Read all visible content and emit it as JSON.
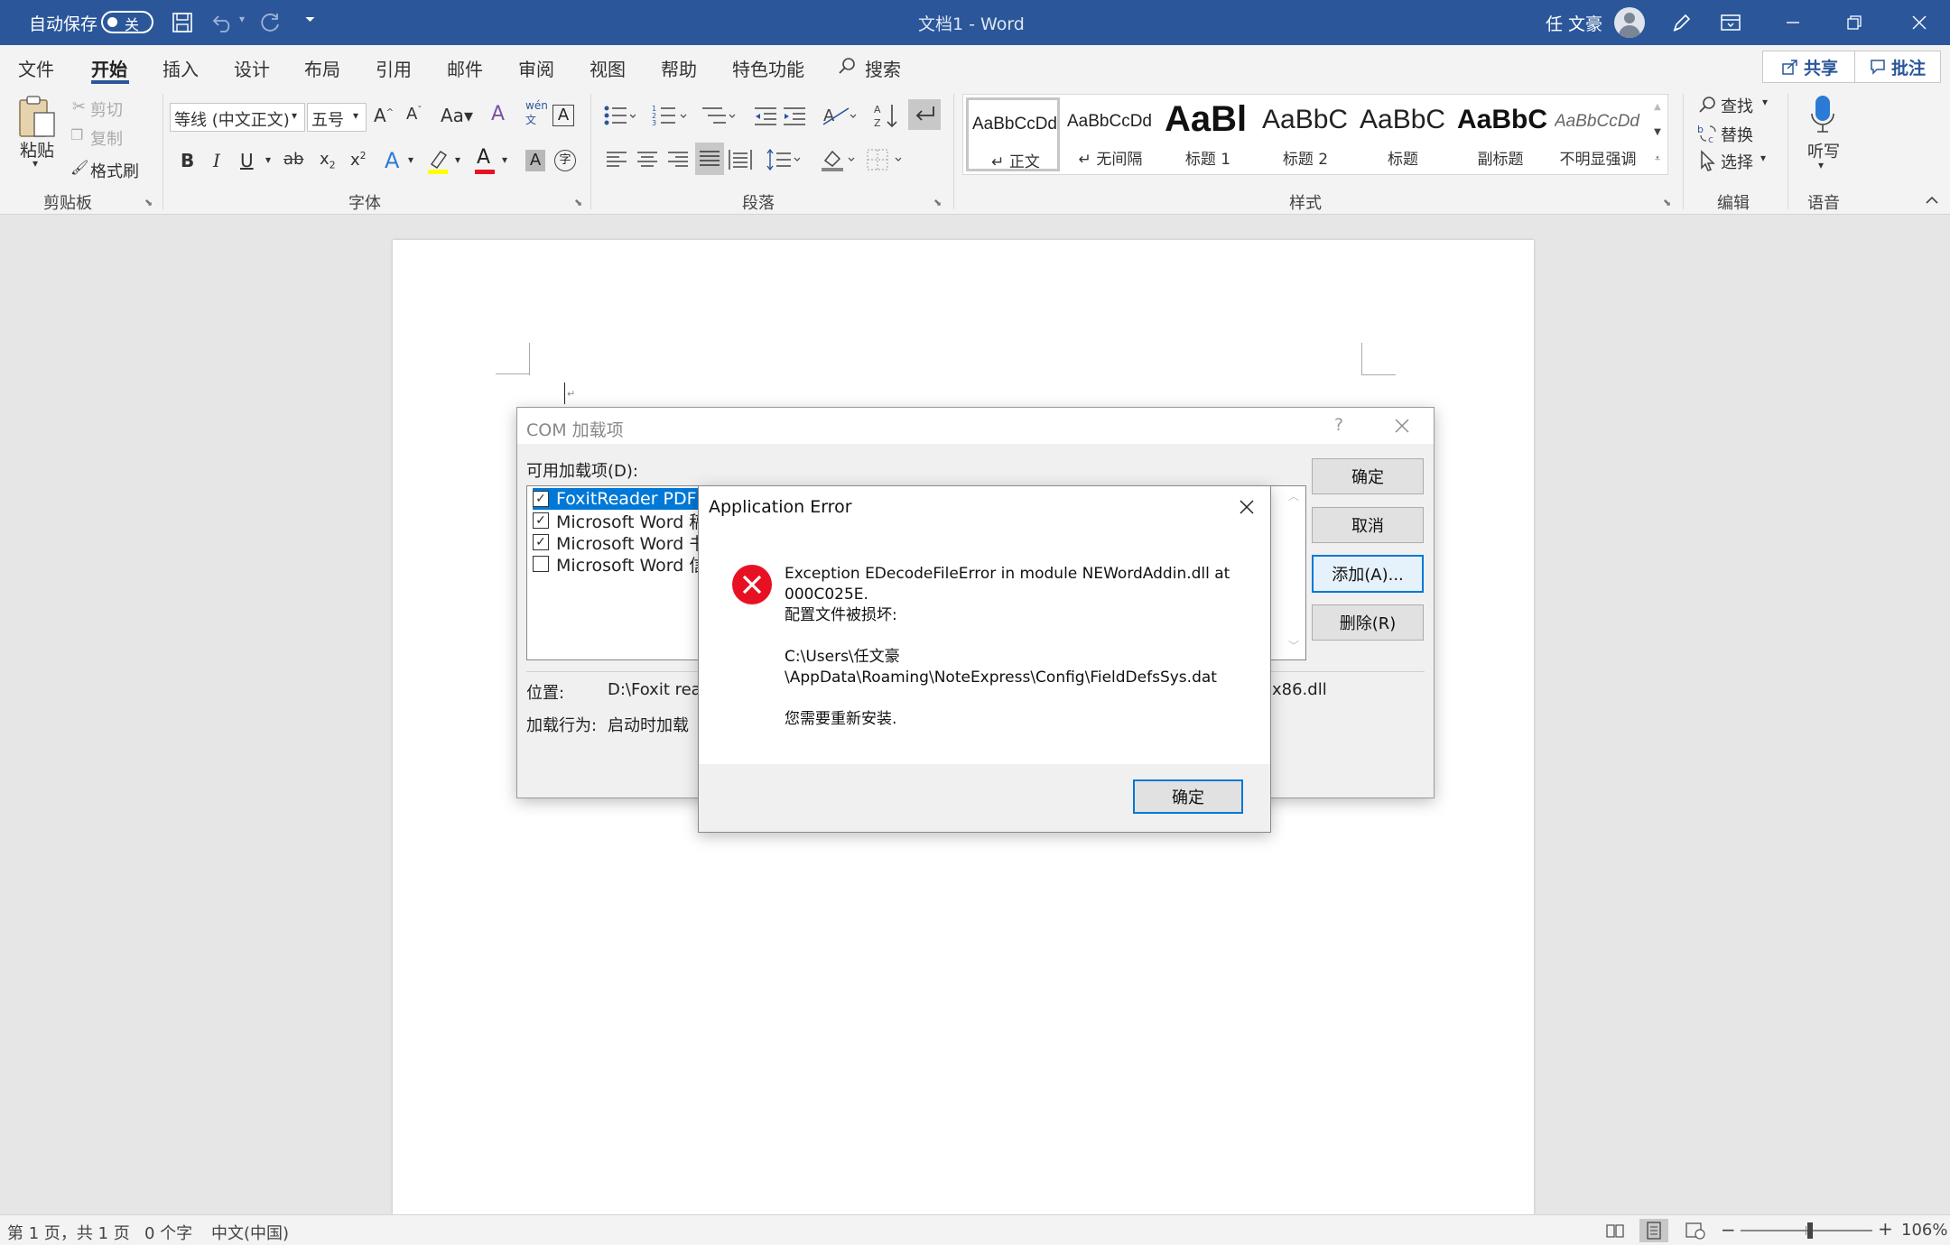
{
  "titlebar": {
    "autosave_label": "自动保存",
    "autosave_state": "关",
    "doc_title": "文档1  -  Word",
    "user_name": "任 文豪"
  },
  "menu": {
    "items": [
      "文件",
      "开始",
      "插入",
      "设计",
      "布局",
      "引用",
      "邮件",
      "审阅",
      "视图",
      "帮助",
      "特色功能"
    ],
    "search": "搜索",
    "share": "共享",
    "comment": "批注"
  },
  "ribbon": {
    "clipboard": {
      "paste": "粘贴",
      "cut": "剪切",
      "copy": "复制",
      "format_painter": "格式刷",
      "label": "剪贴板"
    },
    "font": {
      "font_name": "等线 (中文正文)",
      "font_size": "五号",
      "label": "字体"
    },
    "paragraph": {
      "label": "段落"
    },
    "styles": {
      "items": [
        {
          "preview": "AaBbCcDd",
          "name": "正文"
        },
        {
          "preview": "AaBbCcDd",
          "name": "无间隔"
        },
        {
          "preview": "AaBl",
          "name": "标题 1"
        },
        {
          "preview": "AaBbC",
          "name": "标题 2"
        },
        {
          "preview": "AaBbC",
          "name": "标题"
        },
        {
          "preview": "AaBbC",
          "name": "副标题"
        },
        {
          "preview": "AaBbCcDd",
          "name": "不明显强调"
        }
      ],
      "label": "样式"
    },
    "editing": {
      "find": "查找",
      "replace": "替换",
      "select": "选择",
      "label": "编辑"
    },
    "voice": {
      "dictate": "听写",
      "label": "语音"
    }
  },
  "com_dialog": {
    "title": "COM 加载项",
    "help": "?",
    "available_label": "可用加载项(D):",
    "addins": [
      {
        "name": "FoxitReader PDF Cr",
        "checked": true,
        "selected": true
      },
      {
        "name": "Microsoft Word 稿纸",
        "checked": true,
        "selected": false
      },
      {
        "name": "Microsoft Word 书法",
        "checked": true,
        "selected": false
      },
      {
        "name": "Microsoft Word 信封",
        "checked": false,
        "selected": false
      }
    ],
    "location_label": "位置:",
    "location_value": "D:\\Foxit rea",
    "location_suffix": "x86.dll",
    "behavior_label": "加载行为:",
    "behavior_value": "启动时加载",
    "buttons": {
      "ok": "确定",
      "cancel": "取消",
      "add": "添加(A)...",
      "remove": "删除(R)"
    }
  },
  "error_dialog": {
    "title": "Application Error",
    "message_line1": "Exception EDecodeFileError in module NEWordAddin.dll at",
    "message_line2": "000C025E.",
    "message_line3": "配置文件被损坏:",
    "path_line1": "C:\\Users\\任文豪",
    "path_line2": "\\AppData\\Roaming\\NoteExpress\\Config\\FieldDefsSys.dat",
    "advice": "您需要重新安装.",
    "ok": "确定"
  },
  "statusbar": {
    "page": "第 1 页，共 1 页",
    "words": "0 个字",
    "language": "中文(中国)",
    "zoom": "106%",
    "zoom_level": 0.53
  }
}
